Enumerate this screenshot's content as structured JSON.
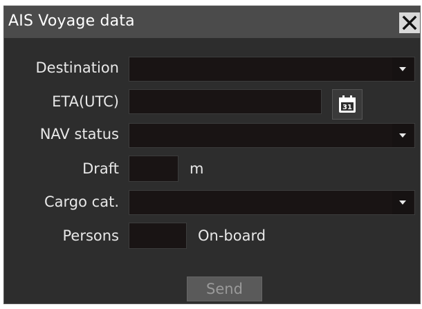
{
  "dialog": {
    "title": "AIS Voyage data"
  },
  "fields": {
    "destination": {
      "label": "Destination",
      "value": ""
    },
    "eta": {
      "label": "ETA(UTC)",
      "value": "",
      "calendar_day": "31"
    },
    "nav_status": {
      "label": "NAV status",
      "value": ""
    },
    "draft": {
      "label": "Draft",
      "value": "",
      "unit": "m"
    },
    "cargo": {
      "label": "Cargo cat.",
      "value": ""
    },
    "persons": {
      "label": "Persons",
      "value": "",
      "unit": "On-board"
    }
  },
  "actions": {
    "send_label": "Send"
  },
  "icons": {
    "close": "close-icon",
    "dropdown": "chevron-down-icon",
    "calendar": "calendar-icon"
  },
  "colors": {
    "dialog_bg": "#2d2d2d",
    "titlebar_bg": "#4b4b4b",
    "field_bg": "#191414"
  }
}
